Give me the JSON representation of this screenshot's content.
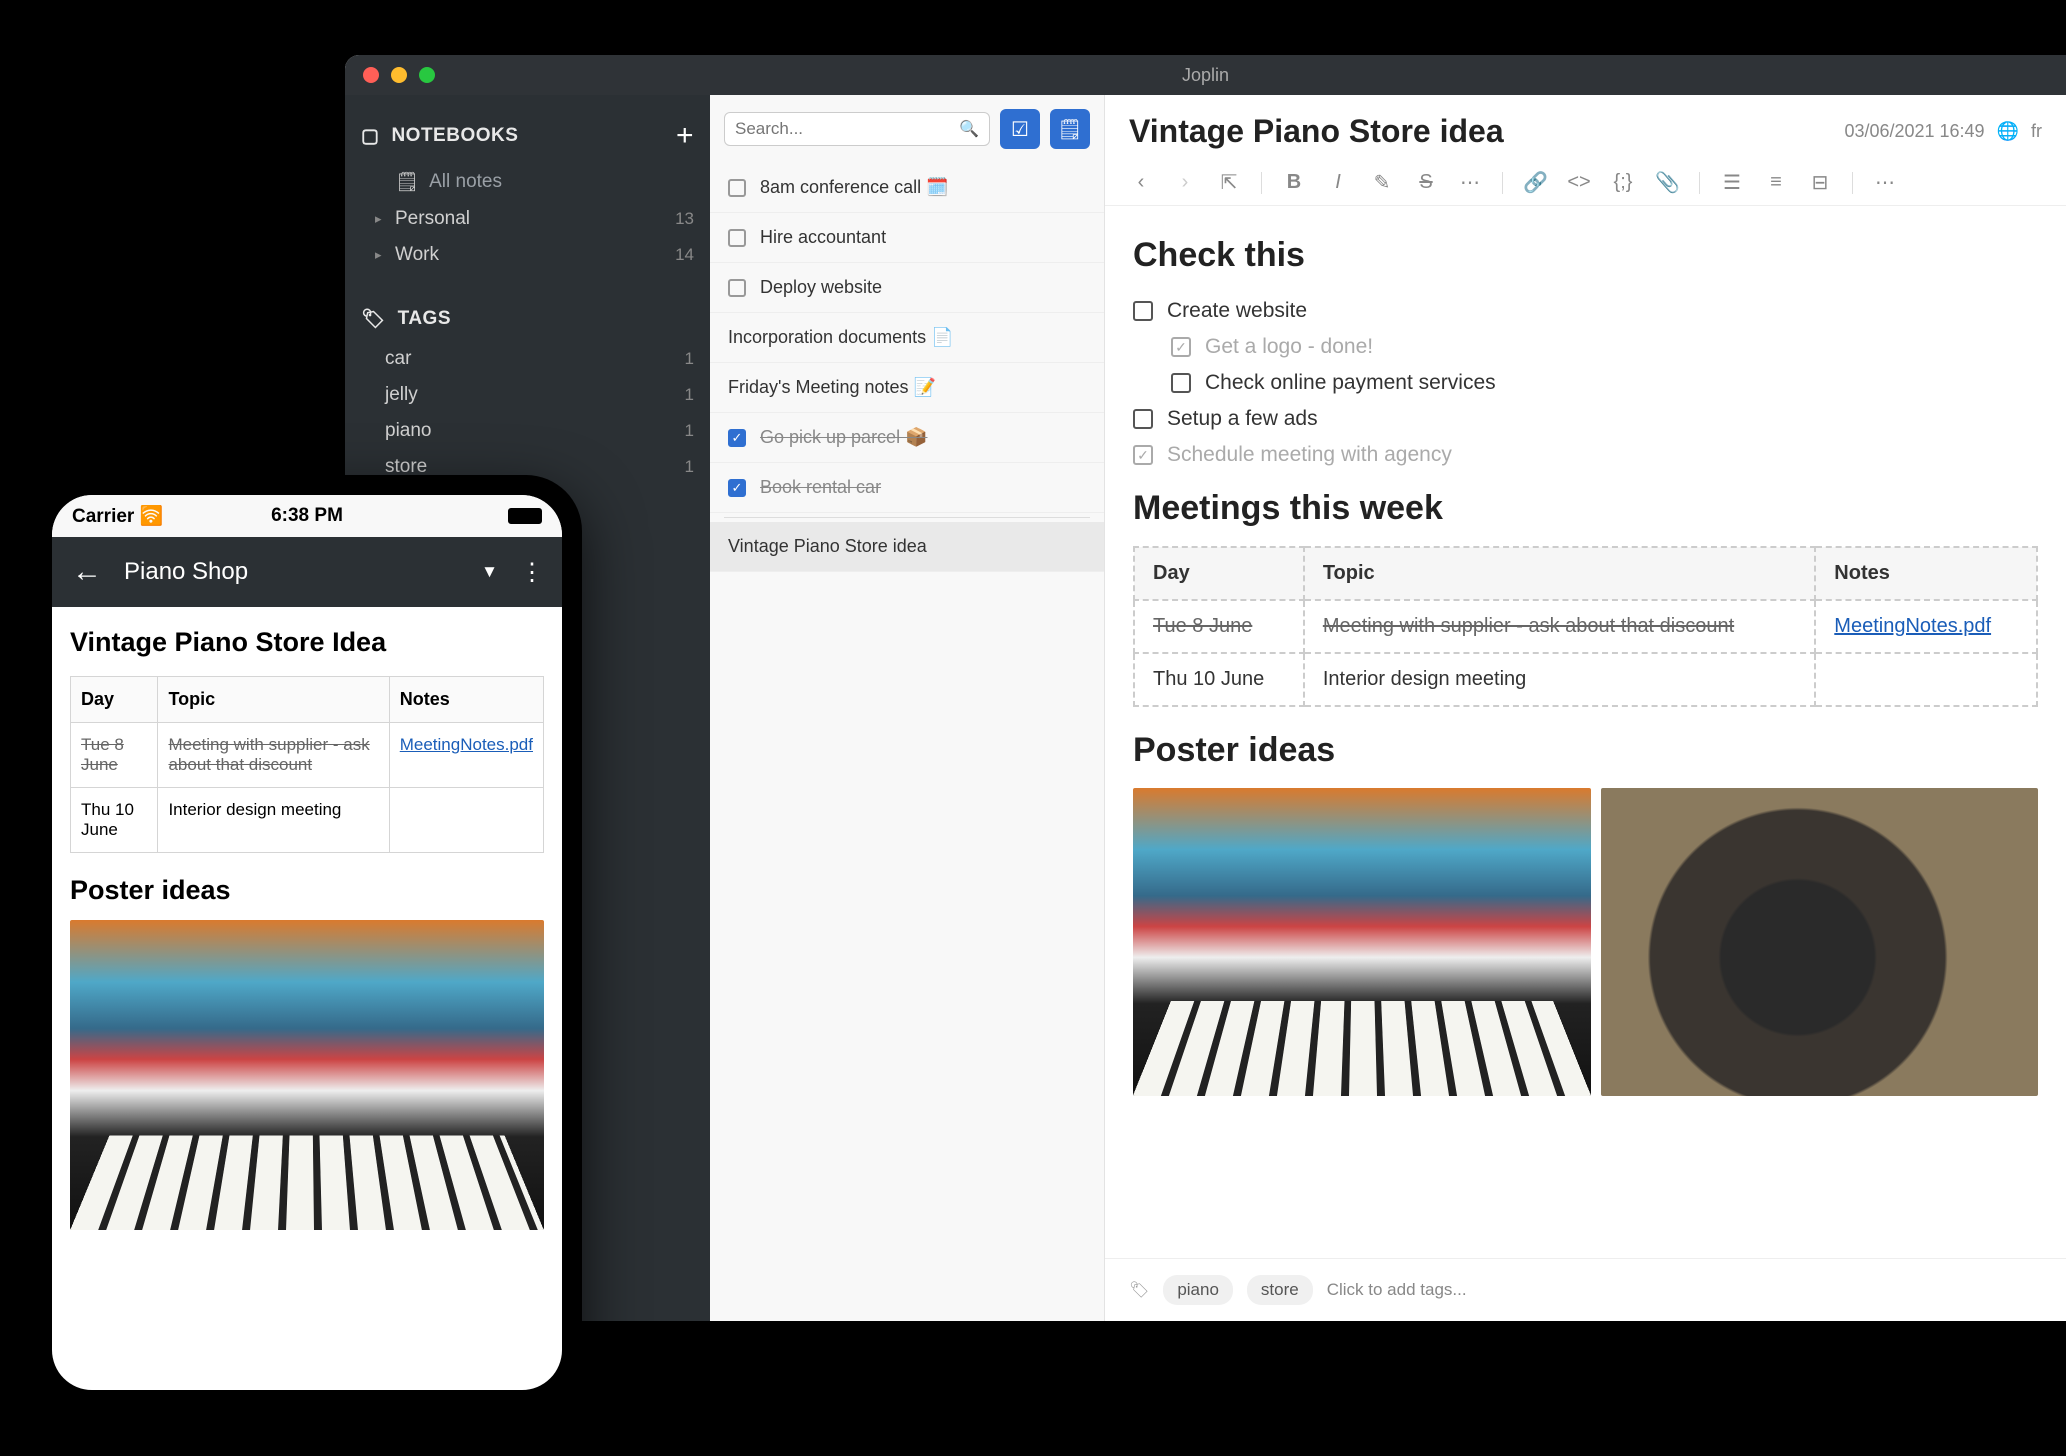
{
  "window": {
    "title": "Joplin"
  },
  "sidebar": {
    "notebooks_label": "NOTEBOOKS",
    "all_notes": "All notes",
    "notebooks": [
      {
        "label": "Personal",
        "count": "13"
      },
      {
        "label": "Work",
        "count": "14"
      }
    ],
    "tags_label": "TAGS",
    "tags": [
      {
        "label": "car",
        "count": "1"
      },
      {
        "label": "jelly",
        "count": "1"
      },
      {
        "label": "piano",
        "count": "1"
      },
      {
        "label": "store",
        "count": "1"
      }
    ]
  },
  "notelist": {
    "search_placeholder": "Search...",
    "items": [
      {
        "title": "8am conference call 🗓️",
        "hasCheckbox": true,
        "checked": false,
        "strike": false
      },
      {
        "title": "Hire accountant",
        "hasCheckbox": true,
        "checked": false,
        "strike": false
      },
      {
        "title": "Deploy website",
        "hasCheckbox": true,
        "checked": false,
        "strike": false
      },
      {
        "title": "Incorporation documents 📄",
        "hasCheckbox": false
      },
      {
        "title": "Friday's Meeting notes 📝",
        "hasCheckbox": false
      },
      {
        "title": "Go pick up parcel 📦",
        "hasCheckbox": true,
        "checked": true,
        "strike": true
      },
      {
        "title": "Book rental car",
        "hasCheckbox": true,
        "checked": true,
        "strike": true
      },
      {
        "title": "Vintage Piano Store idea",
        "hasCheckbox": false,
        "selected": true
      }
    ]
  },
  "editor": {
    "title": "Vintage Piano Store idea",
    "date": "03/06/2021 16:49",
    "lang": "fr",
    "heading_check": "Check this",
    "checklist": [
      {
        "text": "Create website",
        "done": false,
        "sub": false
      },
      {
        "text": "Get a logo - done!",
        "done": true,
        "sub": true
      },
      {
        "text": "Check online payment services",
        "done": false,
        "sub": true
      },
      {
        "text": "Setup a few ads",
        "done": false,
        "sub": false
      },
      {
        "text": "Schedule meeting with agency",
        "done": true,
        "sub": false
      }
    ],
    "heading_meetings": "Meetings this week",
    "table": {
      "headers": {
        "day": "Day",
        "topic": "Topic",
        "notes": "Notes"
      },
      "rows": [
        {
          "day": "Tue 8 June",
          "topic": "Meeting with supplier - ask about that discount",
          "notes": "MeetingNotes.pdf",
          "strike": true,
          "link": true
        },
        {
          "day": "Thu 10 June",
          "topic": "Interior design meeting",
          "notes": "",
          "strike": false
        }
      ]
    },
    "heading_posters": "Poster ideas",
    "tag_chips": [
      "piano",
      "store"
    ],
    "tag_placeholder": "Click to add tags..."
  },
  "hidden_button": "se",
  "mobile": {
    "status": {
      "carrier": "Carrier",
      "time": "6:38 PM"
    },
    "header_title": "Piano Shop",
    "note_title": "Vintage Piano Store Idea",
    "table": {
      "headers": {
        "day": "Day",
        "topic": "Topic",
        "notes": "Notes"
      },
      "rows": [
        {
          "day": "Tue 8 June",
          "topic": "Meeting with supplier - ask about that discount",
          "notes": "MeetingNotes.pdf",
          "strike": true
        },
        {
          "day": "Thu 10 June",
          "topic": "Interior design meeting",
          "notes": "",
          "strike": false
        }
      ]
    },
    "heading_posters": "Poster ideas"
  }
}
